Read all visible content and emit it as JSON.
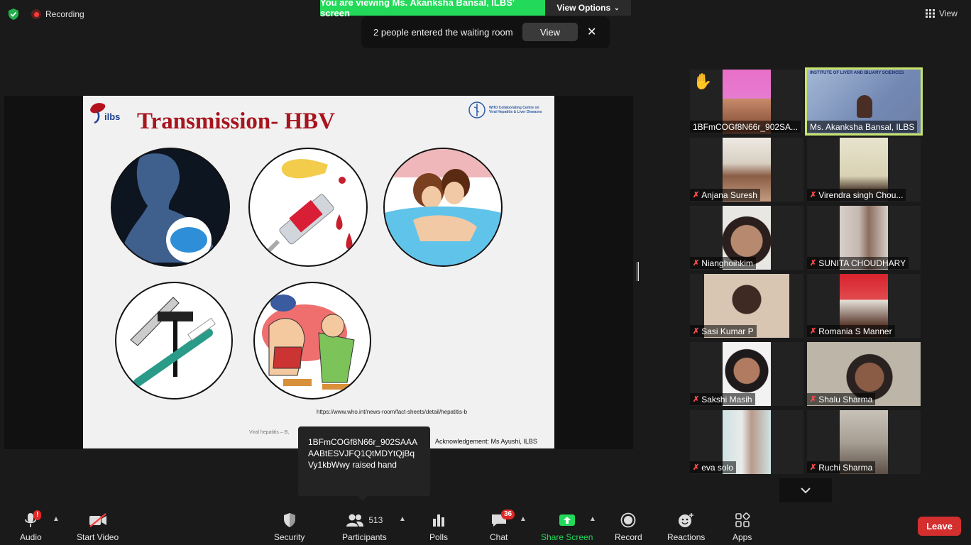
{
  "top": {
    "recording_label": "Recording",
    "viewing_banner": "You are viewing Ms. Akanksha Bansal, ILBS' screen",
    "view_options_label": "View Options",
    "view_label": "View"
  },
  "waiting_room": {
    "message": "2 people entered the waiting room",
    "view_button": "View",
    "close_glyph": "✕"
  },
  "slide": {
    "title": "Transmission- HBV",
    "logo_text": "ilbs",
    "who_text": "WHO Collaborating Centre on Viral Hepatitis & Liver Diseases",
    "url": "https://www.who.int/news-room/fact-sheets/detail/hepatitis-b",
    "footer": "Viral hepatitis – B,",
    "acknowledgement": "Acknowledgement: Ms Ayushi, ILBS",
    "icons": [
      "pregnancy-transmission-icon",
      "blood-syringe-icon",
      "sexual-contact-icon",
      "shared-razor-toothbrush-icon",
      "tattoo-icon"
    ]
  },
  "tooltip": {
    "text": "1BFmCOGf8N66r_902SAAAAABtESVJFQ1QtMDYtQjBqVy1kbWwy raised hand"
  },
  "participants": [
    {
      "name": "1BFmCOGf8N66r_902SA...",
      "muted": false,
      "raised_hand": true
    },
    {
      "name": "Ms. Akanksha Bansal, ILBS",
      "muted": false,
      "active": true,
      "banner_text": "INSTITUTE OF LIVER AND BILIARY SCIENCES"
    },
    {
      "name": "Anjana Suresh",
      "muted": true
    },
    {
      "name": "Virendra singh Chou...",
      "muted": true
    },
    {
      "name": "Nianghoihkim",
      "muted": true
    },
    {
      "name": "SUNITA CHOUDHARY",
      "muted": true
    },
    {
      "name": "Sasi Kumar P",
      "muted": true
    },
    {
      "name": "Romania S Manner",
      "muted": true
    },
    {
      "name": "Sakshi Masih",
      "muted": true
    },
    {
      "name": "Shalu Sharma",
      "muted": true
    },
    {
      "name": "eva solo",
      "muted": true
    },
    {
      "name": "Ruchi Sharma",
      "muted": true
    }
  ],
  "toolbar": {
    "audio": "Audio",
    "audio_badge": "!",
    "start_video": "Start Video",
    "security": "Security",
    "participants": "Participants",
    "participant_count": "513",
    "polls": "Polls",
    "chat": "Chat",
    "chat_badge": "36",
    "share_screen": "Share Screen",
    "record": "Record",
    "reactions": "Reactions",
    "apps": "Apps",
    "leave": "Leave"
  },
  "colors": {
    "banner_green": "#23d959",
    "share_green": "#23d959",
    "leave_red": "#d32f2f",
    "slide_title_red": "#a8141e",
    "active_speaker_outline": "#c7e36b"
  }
}
